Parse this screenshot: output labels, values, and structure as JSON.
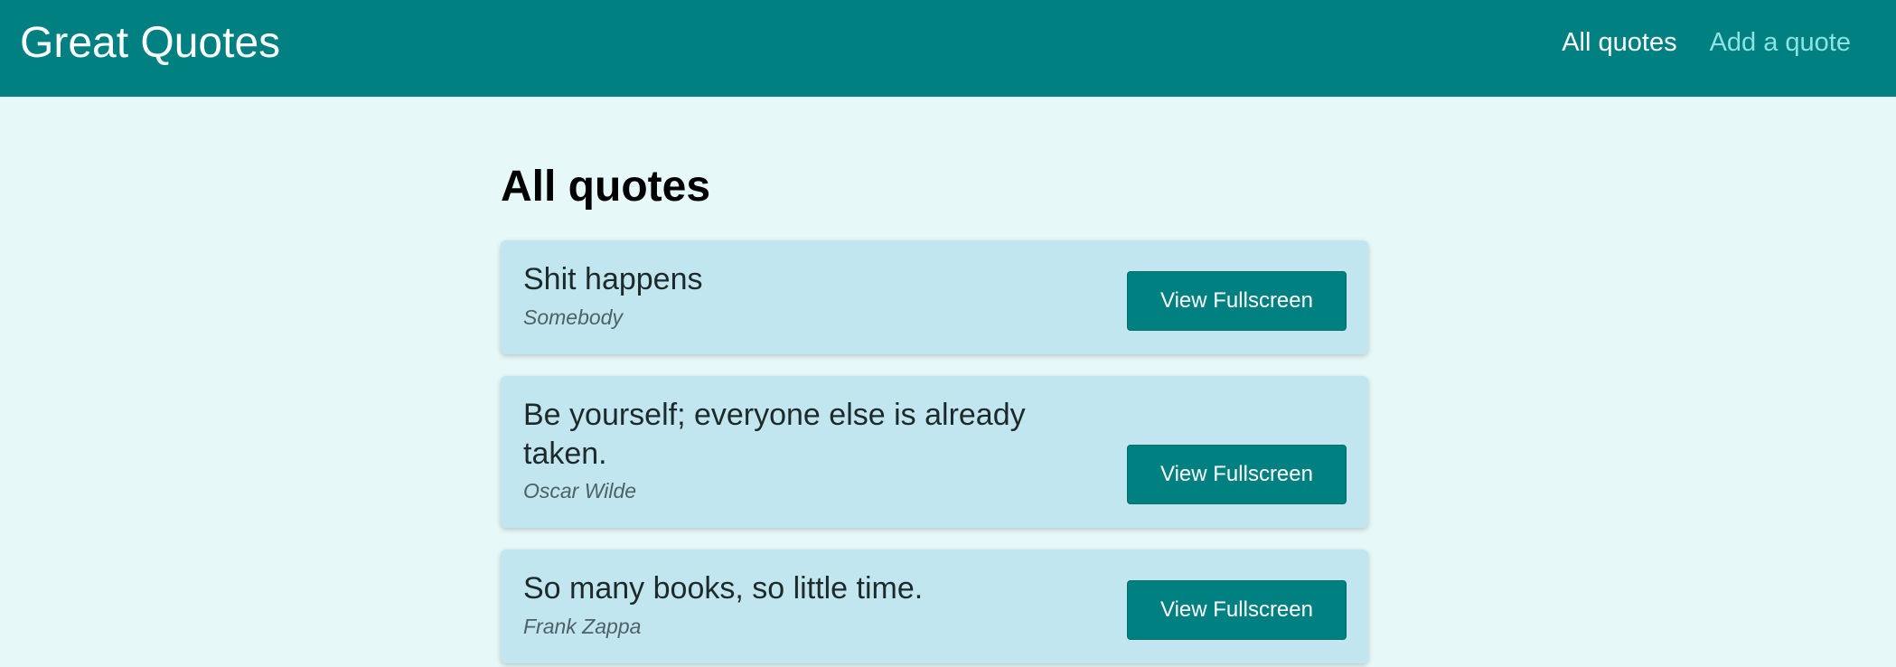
{
  "header": {
    "brand": "Great Quotes",
    "nav": [
      {
        "label": "All quotes",
        "active": true
      },
      {
        "label": "Add a quote",
        "active": false
      }
    ]
  },
  "main": {
    "title": "All quotes",
    "quotes": [
      {
        "text": "Shit happens",
        "author": "Somebody",
        "button": "View Fullscreen"
      },
      {
        "text": "Be yourself; everyone else is already taken.",
        "author": "Oscar Wilde",
        "button": "View Fullscreen"
      },
      {
        "text": "So many books, so little time.",
        "author": "Frank Zappa",
        "button": "View Fullscreen"
      }
    ]
  },
  "colors": {
    "header": "#008080",
    "background": "#e6f8f7",
    "card": "#c1e6ef",
    "nav_active": "#ffffff",
    "nav_inactive": "#8ce3e0"
  }
}
